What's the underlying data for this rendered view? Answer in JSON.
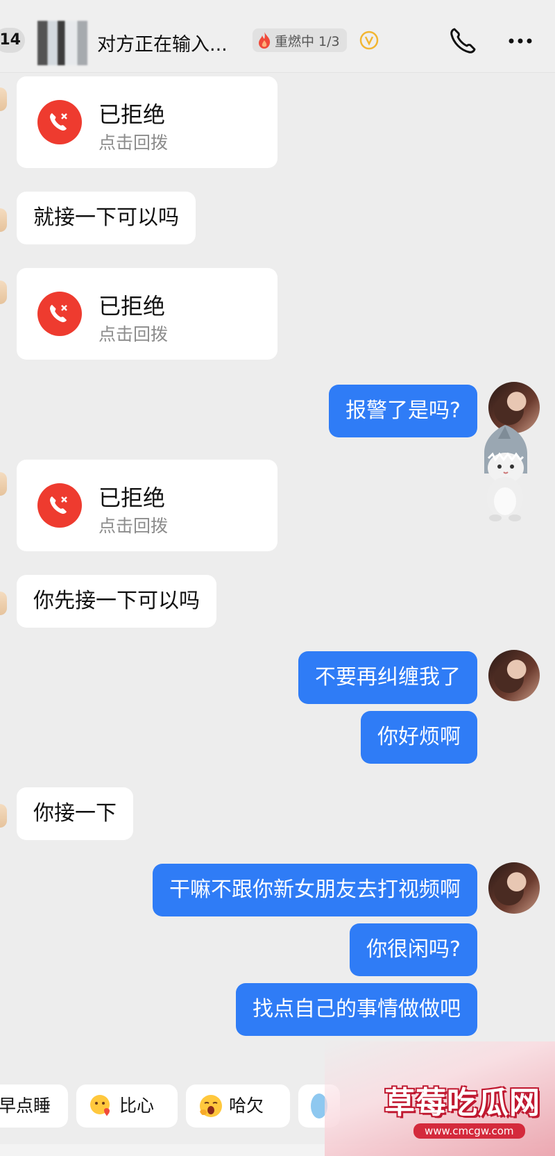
{
  "header": {
    "back_count": "14",
    "title": "对方正在输入...",
    "streak_label": "重燃中 1/3"
  },
  "messages": {
    "call1": {
      "title": "已拒绝",
      "action": "点击回拨"
    },
    "in1": "就接一下可以吗",
    "call2": {
      "title": "已拒绝",
      "action": "点击回拨"
    },
    "out1": "报警了是吗?",
    "call3": {
      "title": "已拒绝",
      "action": "点击回拨"
    },
    "in2": "你先接一下可以吗",
    "out2": "不要再纠缠我了",
    "out3": "你好烦啊",
    "in3": "你接一下",
    "out4": "干嘛不跟你新女朋友去打视频啊",
    "out5": "你很闲吗?",
    "out6": "找点自己的事情做做吧"
  },
  "quick_replies": [
    {
      "label": "早点睡",
      "icon": "moon-emoji-icon"
    },
    {
      "label": "比心",
      "icon": "heart-hands-emoji-icon"
    },
    {
      "label": "哈欠",
      "icon": "yawn-emoji-icon"
    }
  ],
  "watermark": {
    "title": "草莓吃瓜网",
    "url": "www.cmcgw.com"
  },
  "colors": {
    "outgoing_bubble": "#2f7cf6",
    "declined_icon": "#ee3b2f",
    "background": "#ededed"
  }
}
